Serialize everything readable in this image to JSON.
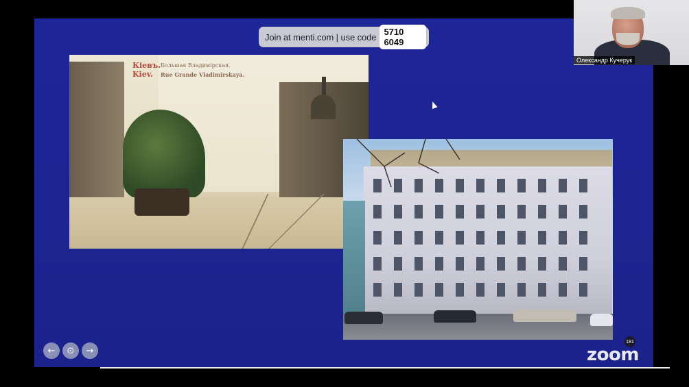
{
  "menti": {
    "join_text": "Join at menti.com | use code",
    "code": "5710 6049"
  },
  "postcard": {
    "caption_cyrillic_city": "Кіевъ.",
    "caption_cyrillic_street": "Большая Владимірская.",
    "caption_latin_city": "Kiev.",
    "caption_latin_street": "Rue Grande Vladimirskaya."
  },
  "participant": {
    "name": "Олександр Кучерук"
  },
  "navigation": {
    "prev_glyph": "←",
    "location_glyph": "⊙",
    "next_glyph": "→"
  },
  "zoom": {
    "logo": "zoom",
    "reaction_count": "181"
  },
  "colors": {
    "slide_background": "#1e2597",
    "menti_bar": "#c9c9d3",
    "nav_button": "#8a8fb8"
  }
}
